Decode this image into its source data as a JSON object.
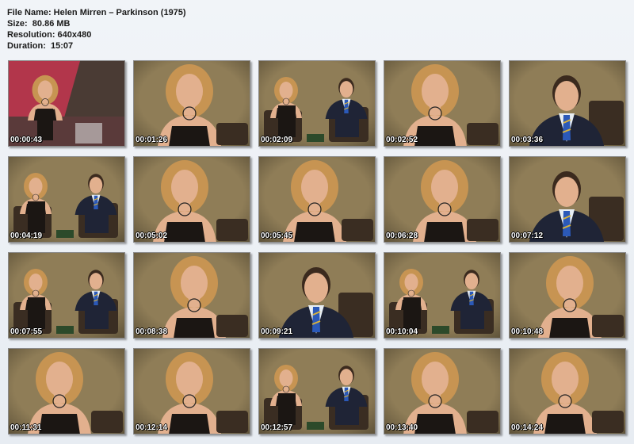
{
  "header": {
    "file_name": "File Name: Helen Mirren – Parkinson (1975)",
    "size": "Size:  80.86 MB",
    "resolution": "Resolution: 640x480",
    "duration": "Duration:  15:07"
  },
  "thumbnails": [
    {
      "time": "00:00:43",
      "scene": "wide-stage"
    },
    {
      "time": "00:01:26",
      "scene": "woman-closeup"
    },
    {
      "time": "00:02:09",
      "scene": "two-shot"
    },
    {
      "time": "00:02:52",
      "scene": "woman-closeup"
    },
    {
      "time": "00:03:36",
      "scene": "man-closeup"
    },
    {
      "time": "00:04:19",
      "scene": "two-shot"
    },
    {
      "time": "00:05:02",
      "scene": "woman-closeup"
    },
    {
      "time": "00:05:45",
      "scene": "woman-closeup"
    },
    {
      "time": "00:06:28",
      "scene": "woman-closeup"
    },
    {
      "time": "00:07:12",
      "scene": "man-closeup"
    },
    {
      "time": "00:07:55",
      "scene": "two-shot"
    },
    {
      "time": "00:08:38",
      "scene": "woman-closeup"
    },
    {
      "time": "00:09:21",
      "scene": "man-closeup"
    },
    {
      "time": "00:10:04",
      "scene": "two-shot"
    },
    {
      "time": "00:10:48",
      "scene": "woman-closeup"
    },
    {
      "time": "00:11:31",
      "scene": "woman-closeup"
    },
    {
      "time": "00:12:14",
      "scene": "woman-closeup"
    },
    {
      "time": "00:12:57",
      "scene": "two-shot"
    },
    {
      "time": "00:13:40",
      "scene": "woman-closeup"
    },
    {
      "time": "00:14:24",
      "scene": "woman-closeup"
    }
  ],
  "colors": {
    "backdrop": "#8f7d57",
    "backdrop_dark": "#6f6042",
    "hair": "#c79452",
    "skin": "#e2b08e",
    "dress": "#1b1613",
    "suit": "#1f2436",
    "shirt": "#e8eef3",
    "tie_blue": "#2b59b8",
    "tie_gold": "#d8b23c",
    "chair": "#3a2d22",
    "stage_red": "#b2364b"
  }
}
